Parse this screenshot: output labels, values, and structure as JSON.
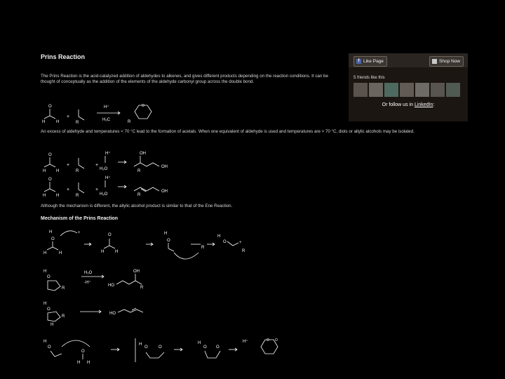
{
  "article": {
    "title": "Prins Reaction",
    "intro": "The Prins Reaction is the acid-catalyzed addition of aldehydes to alkenes, and gives different products depending on the reaction conditions. It can be thought of conceptually as the addition of the elements of the aldehyde carbonyl group across the double bond.",
    "middle": "An excess of aldehyde and temperatures < 70 °C lead to the formation of acetals. When one equivalent of aldehyde is used and temperatures are > 70 °C, diols or allylic alcohols may be isolated.",
    "bridge": "Although the mechanism is different, the allylic alcohol product is similar to that of the Ene Reaction.",
    "mechanism_title": "Mechanism of the Prins Reaction"
  },
  "schemes": {
    "intro": {
      "o": "O",
      "h": "H",
      "r": "R",
      "plus": "+",
      "hplus": "H⁺",
      "reagent": "H₂C",
      "o_ring": "O"
    },
    "diol": {
      "o": "O",
      "h": "H",
      "r": "R",
      "plus": "+",
      "hplus": "H⁺",
      "reagent": "H₂O",
      "oh": "OH"
    },
    "allylic": {
      "o": "O",
      "h": "H",
      "r": "R",
      "plus": "+",
      "hplus": "H⁺",
      "reagent": "H₂O",
      "oh": "OH"
    },
    "mech": {
      "h": "H",
      "o": "O",
      "r": "R",
      "plus": "+",
      "hplus": "H⁺",
      "ho": "HO",
      "oh": "OH",
      "reagent": "H₂O",
      "minus_h": "-H⁺"
    }
  },
  "widget": {
    "like_label": "Like Page",
    "shop_label": "Shop Now",
    "friends_text": "5 friends like this",
    "follow_prefix": "Or follow us in",
    "follow_link": "LinkedIn",
    "follow_suffix": ":",
    "avatars": [
      "",
      "",
      "",
      "",
      "",
      "",
      ""
    ]
  }
}
